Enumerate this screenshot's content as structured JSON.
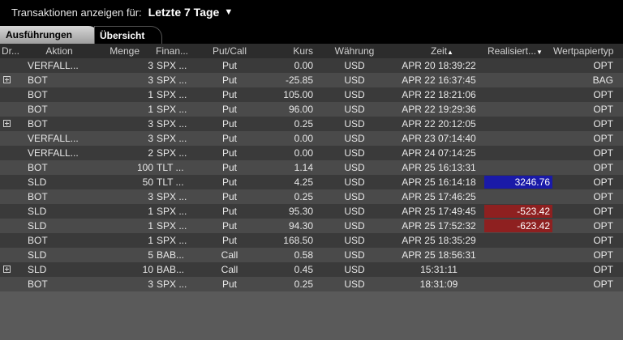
{
  "top": {
    "label": "Transaktionen anzeigen für:",
    "period": "Letzte 7 Tage",
    "caret": "▼"
  },
  "tabs": [
    {
      "label": "Ausführungen",
      "active": true
    },
    {
      "label": "Übersicht",
      "active": false
    }
  ],
  "columns": {
    "dr": "Dr...",
    "aktion": "Aktion",
    "menge": "Menge",
    "finanz": "Finan...",
    "putcall": "Put/Call",
    "kurs": "Kurs",
    "waehrung": "Währung",
    "zeit": "Zeit",
    "zeit_sort": "▲",
    "realisiert": "Realisiert...",
    "realisiert_sort": "▼",
    "typ": "Wertpapiertyp"
  },
  "colors": {
    "positive_bg": "#1a1aa8",
    "negative_bg": "#8e2020"
  },
  "rows": [
    {
      "expand": false,
      "aktion": "VERFALL...",
      "menge": "3",
      "fin": "SPX ...",
      "pc": "Put",
      "kurs": "0.00",
      "cur": "USD",
      "zeit": "APR 20 18:39:22",
      "pl": "",
      "plType": "",
      "typ": "OPT"
    },
    {
      "expand": true,
      "aktion": "BOT",
      "menge": "3",
      "fin": "SPX ...",
      "pc": "Put",
      "kurs": "-25.85",
      "cur": "USD",
      "zeit": "APR 22 16:37:45",
      "pl": "",
      "plType": "",
      "typ": "BAG"
    },
    {
      "expand": false,
      "aktion": "BOT",
      "menge": "1",
      "fin": "SPX ...",
      "pc": "Put",
      "kurs": "105.00",
      "cur": "USD",
      "zeit": "APR 22 18:21:06",
      "pl": "",
      "plType": "",
      "typ": "OPT"
    },
    {
      "expand": false,
      "aktion": "BOT",
      "menge": "1",
      "fin": "SPX ...",
      "pc": "Put",
      "kurs": "96.00",
      "cur": "USD",
      "zeit": "APR 22 19:29:36",
      "pl": "",
      "plType": "",
      "typ": "OPT"
    },
    {
      "expand": true,
      "aktion": "BOT",
      "menge": "3",
      "fin": "SPX ...",
      "pc": "Put",
      "kurs": "0.25",
      "cur": "USD",
      "zeit": "APR 22 20:12:05",
      "pl": "",
      "plType": "",
      "typ": "OPT"
    },
    {
      "expand": false,
      "aktion": "VERFALL...",
      "menge": "3",
      "fin": "SPX ...",
      "pc": "Put",
      "kurs": "0.00",
      "cur": "USD",
      "zeit": "APR 23 07:14:40",
      "pl": "",
      "plType": "",
      "typ": "OPT"
    },
    {
      "expand": false,
      "aktion": "VERFALL...",
      "menge": "2",
      "fin": "SPX ...",
      "pc": "Put",
      "kurs": "0.00",
      "cur": "USD",
      "zeit": "APR 24 07:14:25",
      "pl": "",
      "plType": "",
      "typ": "OPT"
    },
    {
      "expand": false,
      "aktion": "BOT",
      "menge": "100",
      "fin": "TLT ...",
      "pc": "Put",
      "kurs": "1.14",
      "cur": "USD",
      "zeit": "APR 25 16:13:31",
      "pl": "",
      "plType": "",
      "typ": "OPT"
    },
    {
      "expand": false,
      "aktion": "SLD",
      "menge": "50",
      "fin": "TLT ...",
      "pc": "Put",
      "kurs": "4.25",
      "cur": "USD",
      "zeit": "APR 25 16:14:18",
      "pl": "3246.76",
      "plType": "pos",
      "typ": "OPT"
    },
    {
      "expand": false,
      "aktion": "BOT",
      "menge": "3",
      "fin": "SPX ...",
      "pc": "Put",
      "kurs": "0.25",
      "cur": "USD",
      "zeit": "APR 25 17:46:25",
      "pl": "",
      "plType": "",
      "typ": "OPT"
    },
    {
      "expand": false,
      "aktion": "SLD",
      "menge": "1",
      "fin": "SPX ...",
      "pc": "Put",
      "kurs": "95.30",
      "cur": "USD",
      "zeit": "APR 25 17:49:45",
      "pl": "-523.42",
      "plType": "neg",
      "typ": "OPT"
    },
    {
      "expand": false,
      "aktion": "SLD",
      "menge": "1",
      "fin": "SPX ...",
      "pc": "Put",
      "kurs": "94.30",
      "cur": "USD",
      "zeit": "APR 25 17:52:32",
      "pl": "-623.42",
      "plType": "neg",
      "typ": "OPT"
    },
    {
      "expand": false,
      "aktion": "BOT",
      "menge": "1",
      "fin": "SPX ...",
      "pc": "Put",
      "kurs": "168.50",
      "cur": "USD",
      "zeit": "APR 25 18:35:29",
      "pl": "",
      "plType": "",
      "typ": "OPT"
    },
    {
      "expand": false,
      "aktion": "SLD",
      "menge": "5",
      "fin": "BAB...",
      "pc": "Call",
      "kurs": "0.58",
      "cur": "USD",
      "zeit": "APR 25 18:56:31",
      "pl": "",
      "plType": "",
      "typ": "OPT"
    },
    {
      "expand": true,
      "aktion": "SLD",
      "menge": "10",
      "fin": "BAB...",
      "pc": "Call",
      "kurs": "0.45",
      "cur": "USD",
      "zeit": "15:31:11",
      "pl": "",
      "plType": "",
      "typ": "OPT"
    },
    {
      "expand": false,
      "aktion": "BOT",
      "menge": "3",
      "fin": "SPX ...",
      "pc": "Put",
      "kurs": "0.25",
      "cur": "USD",
      "zeit": "18:31:09",
      "pl": "",
      "plType": "",
      "typ": "OPT"
    }
  ]
}
